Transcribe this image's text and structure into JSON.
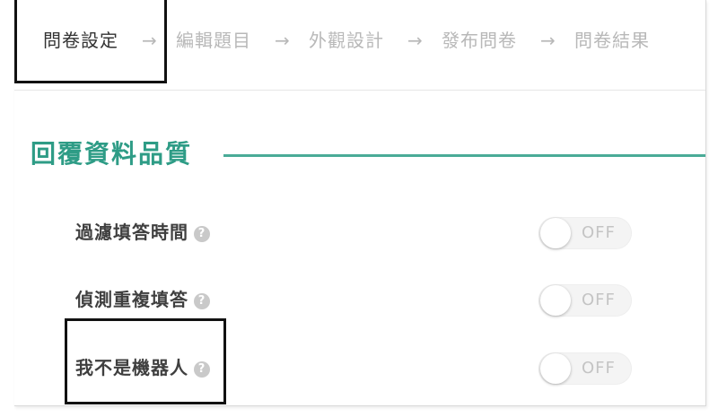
{
  "steps": [
    {
      "label": "問卷設定",
      "active": true
    },
    {
      "label": "編輯題目",
      "active": false
    },
    {
      "label": "外觀設計",
      "active": false
    },
    {
      "label": "發布問卷",
      "active": false
    },
    {
      "label": "問卷結果",
      "active": false
    }
  ],
  "arrow_glyph": "→",
  "section": {
    "title": "回覆資料品質"
  },
  "settings": [
    {
      "label": "過濾填答時間",
      "help": "?",
      "toggle": "OFF"
    },
    {
      "label": "偵測重複填答",
      "help": "?",
      "toggle": "OFF"
    },
    {
      "label": "我不是機器人",
      "help": "?",
      "toggle": "OFF"
    }
  ],
  "colors": {
    "accent": "#2e9c86",
    "active_text": "#333333",
    "inactive_text": "#b8b8b8"
  }
}
